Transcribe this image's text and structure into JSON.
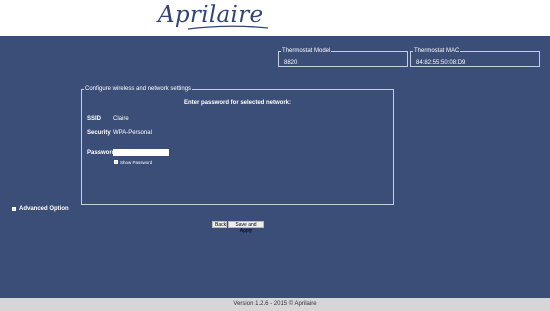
{
  "brand": {
    "logo_text": "Aprilaire"
  },
  "thermostat": {
    "model_legend": "Thermostat Model",
    "model_value": "8820",
    "mac_legend": "Thermostat MAC",
    "mac_value": "84:82:55:50:08:D9"
  },
  "wireless": {
    "legend": "Configure wireless and network settings",
    "title": "Enter password for selected network:",
    "ssid_label": "SSID",
    "ssid_value": "Claire",
    "security_label": "Security",
    "security_value": "WPA-Personal",
    "password_label": "Password",
    "password_value": "",
    "show_password_label": "Show Password",
    "show_password_checked": false
  },
  "advanced": {
    "label": "Advanced Option",
    "checked": false
  },
  "buttons": {
    "back": "Back",
    "save_apply": "Save and Apply"
  },
  "footer": {
    "text": "Version 1.2.6 - 2015 © Aprilaire"
  }
}
